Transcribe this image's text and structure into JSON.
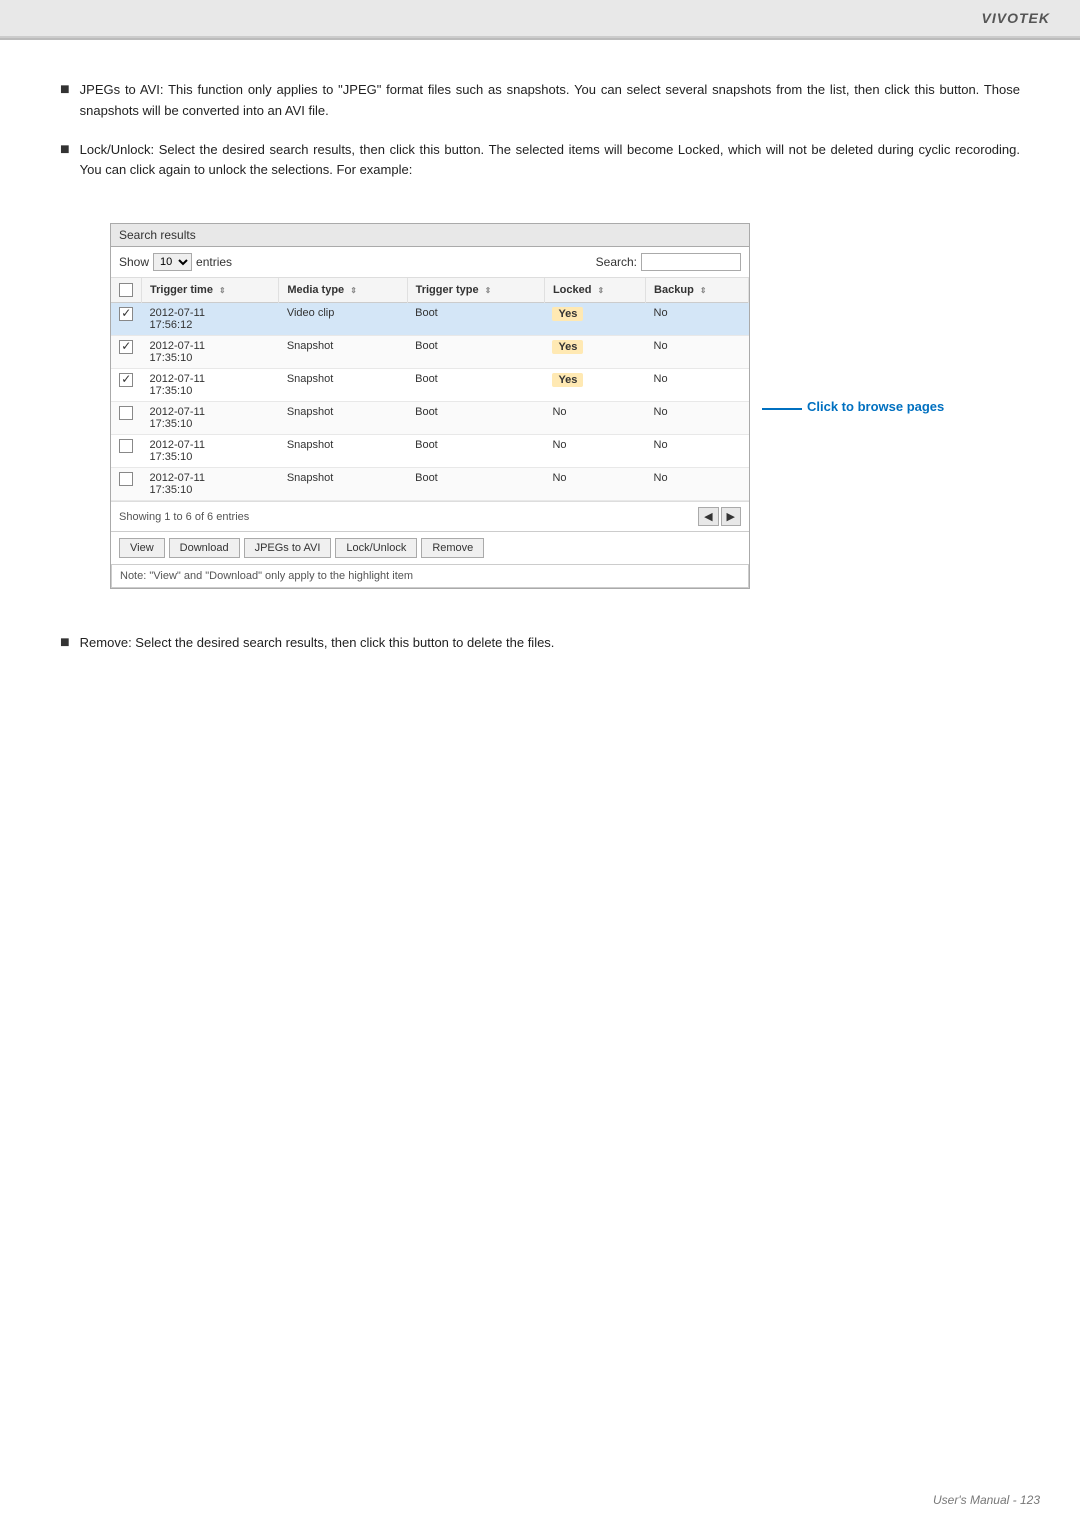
{
  "brand": "VIVOTEK",
  "footer": "User's Manual - 123",
  "bullets": [
    {
      "id": "jpegs-bullet",
      "text": "JPEGs to AVI: This function only applies to \"JPEG\" format files such as snapshots. You can select several snapshots from the list, then click this button. Those snapshots will be converted into an AVI file."
    },
    {
      "id": "lockunlock-bullet",
      "text": "Lock/Unlock: Select the desired search results, then click this button. The selected items will become Locked, which will not be deleted during cyclic recoroding. You can click again to unlock the selections. For example:"
    },
    {
      "id": "remove-bullet",
      "text": "Remove: Select the desired search results, then click this button to delete the files."
    }
  ],
  "search_results": {
    "title": "Search results",
    "show_label": "Show",
    "show_value": "10",
    "entries_label": "entries",
    "search_label": "Search:",
    "search_placeholder": "",
    "columns": [
      {
        "label": "",
        "sortable": false
      },
      {
        "label": "Trigger time",
        "sortable": true
      },
      {
        "label": "Media type",
        "sortable": true
      },
      {
        "label": "Trigger type",
        "sortable": true
      },
      {
        "label": "Locked",
        "sortable": true
      },
      {
        "label": "Backup",
        "sortable": true
      }
    ],
    "rows": [
      {
        "checked": true,
        "highlighted": true,
        "trigger_time": "2012-07-11\n17:56:12",
        "media_type": "Video clip",
        "trigger_type": "Boot",
        "locked": "Yes",
        "backup": "No"
      },
      {
        "checked": true,
        "highlighted": false,
        "trigger_time": "2012-07-11\n17:35:10",
        "media_type": "Snapshot",
        "trigger_type": "Boot",
        "locked": "Yes",
        "backup": "No"
      },
      {
        "checked": true,
        "highlighted": false,
        "trigger_time": "2012-07-11\n17:35:10",
        "media_type": "Snapshot",
        "trigger_type": "Boot",
        "locked": "Yes",
        "backup": "No"
      },
      {
        "checked": false,
        "highlighted": false,
        "trigger_time": "2012-07-11\n17:35:10",
        "media_type": "Snapshot",
        "trigger_type": "Boot",
        "locked": "No",
        "backup": "No"
      },
      {
        "checked": false,
        "highlighted": false,
        "trigger_time": "2012-07-11\n17:35:10",
        "media_type": "Snapshot",
        "trigger_type": "Boot",
        "locked": "No",
        "backup": "No"
      },
      {
        "checked": false,
        "highlighted": false,
        "trigger_time": "2012-07-11\n17:35:10",
        "media_type": "Snapshot",
        "trigger_type": "Boot",
        "locked": "No",
        "backup": "No"
      }
    ],
    "showing_text": "Showing 1 to 6 of 6 entries",
    "buttons": [
      {
        "id": "view-btn",
        "label": "View"
      },
      {
        "id": "download-btn",
        "label": "Download"
      },
      {
        "id": "jpegs-avi-btn",
        "label": "JPEGs to AVI"
      },
      {
        "id": "lock-unlock-btn",
        "label": "Lock/Unlock"
      },
      {
        "id": "remove-btn",
        "label": "Remove"
      }
    ],
    "note": "Note: \"View\" and \"Download\" only apply to the highlight item",
    "annotation": {
      "text": "Click to browse\npages",
      "line_visible": true
    }
  }
}
